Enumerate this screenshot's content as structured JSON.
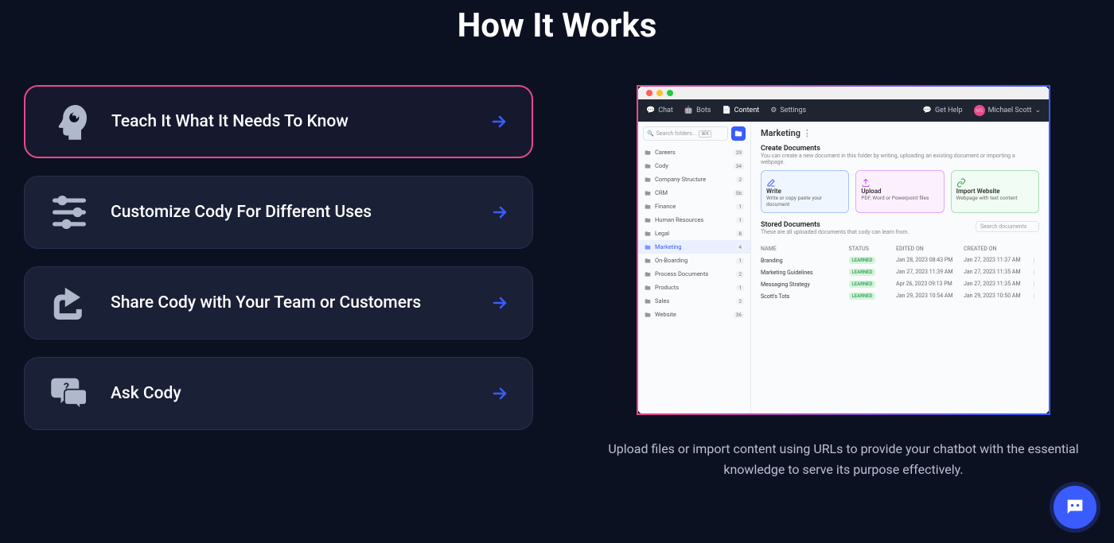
{
  "title": "How It Works",
  "steps": [
    {
      "label": "Teach It What It Needs To Know",
      "active": true
    },
    {
      "label": "Customize Cody For Different Uses",
      "active": false
    },
    {
      "label": "Share Cody with Your Team or Customers",
      "active": false
    },
    {
      "label": "Ask Cody",
      "active": false
    }
  ],
  "description": "Upload files or import content using URLs to provide your chatbot with the essential knowledge to serve its purpose effectively.",
  "preview": {
    "topbar": {
      "chat": "Chat",
      "bots": "Bots",
      "content": "Content",
      "settings": "Settings",
      "help": "Get Help",
      "user": "Michael Scott",
      "avatar": "MS"
    },
    "search_placeholder": "Search folders...",
    "kbd": "⌘K",
    "folders": [
      {
        "name": "Careers",
        "count": "29"
      },
      {
        "name": "Cody",
        "count": "34"
      },
      {
        "name": "Company Structure",
        "count": "2"
      },
      {
        "name": "CRM",
        "count": "56"
      },
      {
        "name": "Finance",
        "count": "1"
      },
      {
        "name": "Human Resources",
        "count": "1"
      },
      {
        "name": "Legal",
        "count": "8"
      },
      {
        "name": "Marketing",
        "count": "4",
        "selected": true
      },
      {
        "name": "On-Boarding",
        "count": "1"
      },
      {
        "name": "Process Documents",
        "count": "2"
      },
      {
        "name": "Products",
        "count": "1"
      },
      {
        "name": "Sales",
        "count": "2"
      },
      {
        "name": "Website",
        "count": "36"
      }
    ],
    "content": {
      "title": "Marketing",
      "create_title": "Create Documents",
      "create_sub": "You can create a new document in this folder by writing, uploading an existing document or importing a webpage.",
      "cards": {
        "write": {
          "title": "Write",
          "sub": "Write or copy paste your document"
        },
        "upload": {
          "title": "Upload",
          "sub": "PDF, Word or Powerpoint files"
        },
        "import": {
          "title": "Import Website",
          "sub": "Webpage with text content"
        }
      },
      "stored_title": "Stored Documents",
      "stored_sub": "These are all uploaded documents that cody can learn from.",
      "search_docs": "Search documents",
      "columns": {
        "name": "NAME",
        "status": "STATUS",
        "edited": "EDITED ON",
        "created": "CREATED ON"
      },
      "rows": [
        {
          "name": "Branding",
          "status": "LEARNED",
          "edited": "Jan 28, 2023 08:43 PM",
          "created": "Jan 27, 2023 11:37 AM"
        },
        {
          "name": "Marketing Guidelines",
          "status": "LEARNED",
          "edited": "Jan 27, 2023 11:39 AM",
          "created": "Jan 27, 2023 11:35 AM"
        },
        {
          "name": "Messaging Strategy",
          "status": "LEARNED",
          "edited": "Apr 26, 2023 09:13 PM",
          "created": "Jan 27, 2023 11:35 AM"
        },
        {
          "name": "Scott's Tots",
          "status": "LEARNED",
          "edited": "Jan 29, 2023 10:54 AM",
          "created": "Jan 29, 2023 10:50 AM"
        }
      ]
    }
  }
}
